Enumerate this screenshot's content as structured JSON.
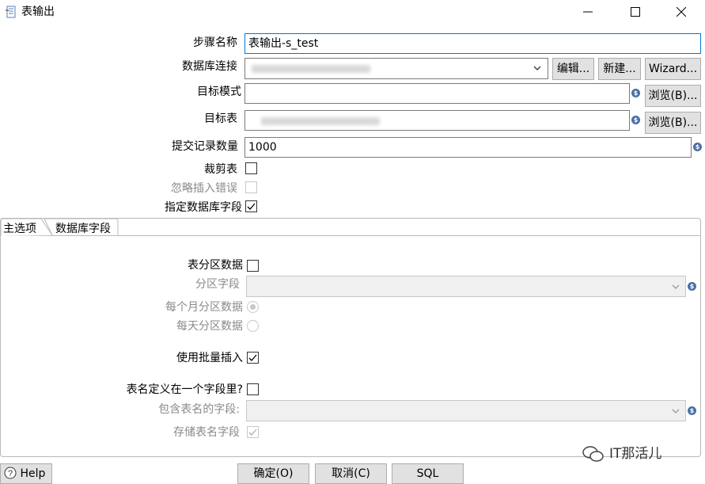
{
  "window": {
    "title": "表输出",
    "minimize_glyph": "—",
    "maximize_glyph": "☐",
    "close_glyph": "✕"
  },
  "form": {
    "step_name": {
      "label": "步骤名称",
      "value": "表输出-s_test"
    },
    "db_connection": {
      "label": "数据库连接",
      "edit_button": "编辑...",
      "new_button": "新建...",
      "wizard_button": "Wizard..."
    },
    "target_schema": {
      "label": "目标模式",
      "value": "",
      "browse_button": "浏览(B)..."
    },
    "target_table": {
      "label": "目标表",
      "browse_button": "浏览(B)..."
    },
    "commit_size": {
      "label": "提交记录数量",
      "value": "1000"
    },
    "truncate_table": {
      "label": "裁剪表",
      "checked": false
    },
    "ignore_insert_errors": {
      "label": "忽略插入错误",
      "checked": false,
      "disabled": true
    },
    "specify_db_fields": {
      "label": "指定数据库字段",
      "checked": true
    }
  },
  "tabs": [
    {
      "label": "主选项",
      "active": true
    },
    {
      "label": "数据库字段",
      "active": false
    }
  ],
  "main_options": {
    "partition_data": {
      "label": "表分区数据",
      "checked": false
    },
    "partition_field": {
      "label": "分区字段"
    },
    "monthly_partition": {
      "label": "每个月分区数据"
    },
    "daily_partition": {
      "label": "每天分区数据"
    },
    "batch_insert": {
      "label": "使用批量插入",
      "checked": true
    },
    "table_name_in_field": {
      "label": "表名定义在一个字段里?",
      "checked": false
    },
    "table_name_field": {
      "label": "包含表名的字段:"
    },
    "store_table_name_field": {
      "label": "存储表名字段",
      "checked": true,
      "disabled": true
    }
  },
  "bottom": {
    "help_button": "Help",
    "ok_button": "确定(O)",
    "cancel_button": "取消(C)",
    "sql_button": "SQL",
    "watermark": "IT那活儿"
  },
  "colors": {
    "focus": "#0078d7",
    "variable_icon": "#4a6fa5"
  }
}
